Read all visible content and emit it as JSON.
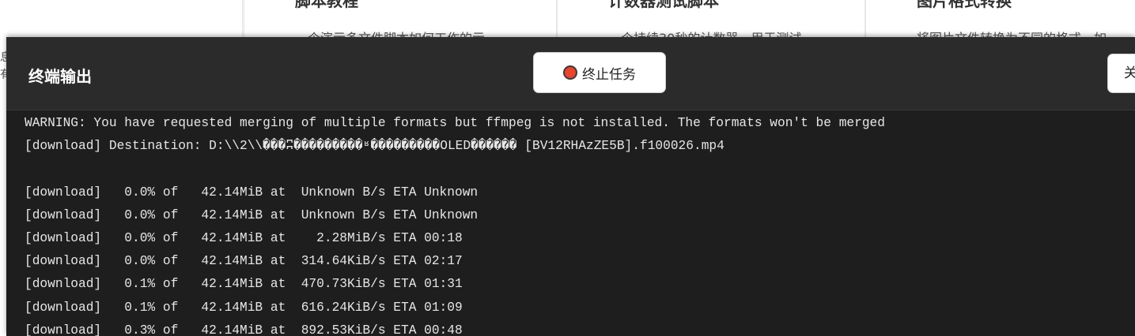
{
  "background": {
    "sidebar_edge_lines": [
      "息",
      "有"
    ],
    "cards": [
      {
        "title": "脚本教程",
        "desc": "一个演示多文件脚本如何工作的示"
      },
      {
        "title": "计数器测试脚本",
        "desc": "一个持续30秒的计数器，用于测试"
      },
      {
        "title": "图片格式转换",
        "desc": "将图片文件转换为不同的格式，如"
      }
    ]
  },
  "terminal": {
    "title": "终端输出",
    "stop_label": "终止任务",
    "close_label": "关闭",
    "lines": [
      "WARNING: You have requested merging of multiple formats but ffmpeg is not installed. The formats won't be merged",
      "[download] Destination: D:\\\\2\\\\���ʭ���������ʶ���������OLED������ [BV12RHAzZE5B].f100026.mp4",
      "",
      "[download]   0.0% of   42.14MiB at  Unknown B/s ETA Unknown",
      "[download]   0.0% of   42.14MiB at  Unknown B/s ETA Unknown",
      "[download]   0.0% of   42.14MiB at    2.28MiB/s ETA 00:18",
      "[download]   0.0% of   42.14MiB at  314.64KiB/s ETA 02:17",
      "[download]   0.1% of   42.14MiB at  470.73KiB/s ETA 01:31",
      "[download]   0.1% of   42.14MiB at  616.24KiB/s ETA 01:09",
      "[download]   0.3% of   42.14MiB at  892.53KiB/s ETA 00:48"
    ]
  },
  "colors": {
    "terminal_bg": "#1e1e1e",
    "header_bg": "#2b2b2b",
    "text": "#e6e6e6",
    "stop_red": "#e8452b"
  }
}
